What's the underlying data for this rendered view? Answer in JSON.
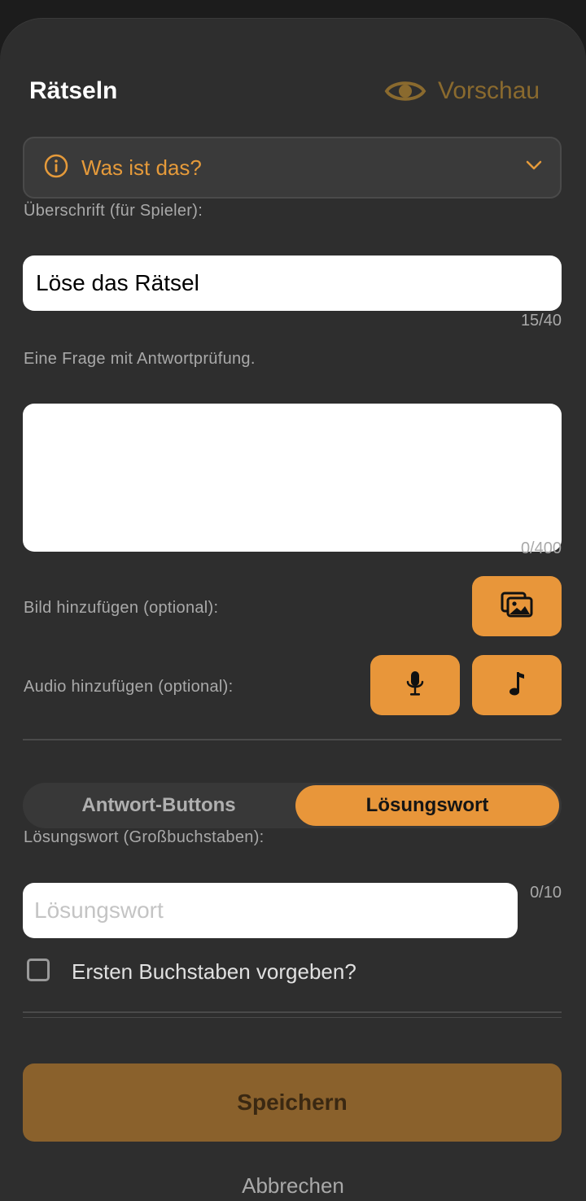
{
  "header": {
    "title": "Rätseln",
    "preview_label": "Vorschau"
  },
  "type_select": {
    "value": "Was ist das?"
  },
  "heading": {
    "label": "Überschrift (für Spieler):",
    "value": "Löse das Rätsel",
    "counter": "15/40"
  },
  "question": {
    "label": "Eine Frage mit Antwortprüfung.",
    "value": "",
    "counter": "0/400"
  },
  "image": {
    "label": "Bild hinzufügen (optional):"
  },
  "audio": {
    "label": "Audio hinzufügen (optional):"
  },
  "answer_mode": {
    "options": [
      "Antwort-Buttons",
      "Lösungswort"
    ],
    "selected": "Lösungswort"
  },
  "solution": {
    "label": "Lösungswort (Großbuchstaben):",
    "placeholder": "Lösungswort",
    "value": "",
    "counter": "0/10"
  },
  "first_letter": {
    "label": "Ersten Buchstaben vorgeben?",
    "checked": false
  },
  "actions": {
    "save_label": "Speichern",
    "cancel_label": "Abbrechen"
  },
  "colors": {
    "accent": "#e8963a",
    "save_disabled": "#8a612c",
    "background": "#2e2e2e"
  }
}
